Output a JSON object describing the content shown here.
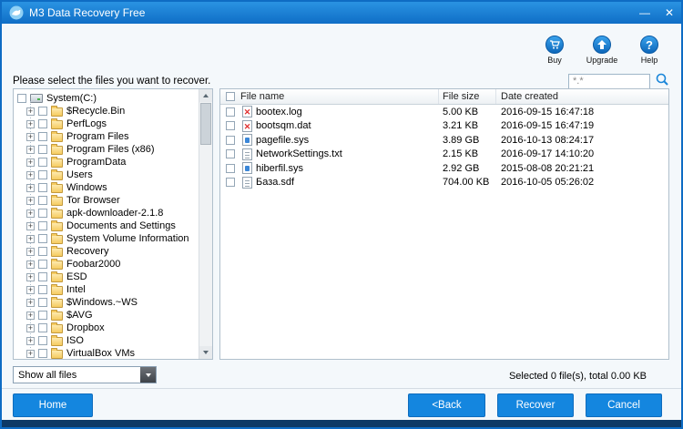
{
  "window": {
    "title": "M3 Data Recovery Free",
    "minimize": "—",
    "close": "✕"
  },
  "toolbar": {
    "items": [
      {
        "label": "Buy"
      },
      {
        "label": "Upgrade"
      },
      {
        "label": "Help"
      }
    ]
  },
  "instruction": "Please select the files you want to recover.",
  "search": {
    "value": "*.*"
  },
  "tree": {
    "root": "System(C:)",
    "items": [
      "$Recycle.Bin",
      "PerfLogs",
      "Program Files",
      "Program Files (x86)",
      "ProgramData",
      "Users",
      "Windows",
      "Tor Browser",
      "apk-downloader-2.1.8",
      "Documents and Settings",
      "System Volume Information",
      "Recovery",
      "Foobar2000",
      "ESD",
      "Intel",
      "$Windows.~WS",
      "$AVG",
      "Dropbox",
      "ISO",
      "VirtualBox VMs"
    ]
  },
  "filter": {
    "value": "Show all files"
  },
  "file_table": {
    "headers": [
      "File name",
      "File size",
      "Date created"
    ],
    "rows": [
      {
        "name": "bootex.log",
        "size": "5.00 KB",
        "date": "2016-09-15 16:47:18",
        "icon": "deleted-file-icon"
      },
      {
        "name": "bootsqm.dat",
        "size": "3.21 KB",
        "date": "2016-09-15 16:47:19",
        "icon": "deleted-file-icon"
      },
      {
        "name": "pagefile.sys",
        "size": "3.89 GB",
        "date": "2016-10-13 08:24:17",
        "icon": "system-file-icon"
      },
      {
        "name": "NetworkSettings.txt",
        "size": "2.15 KB",
        "date": "2016-09-17 14:10:20",
        "icon": "text-file-icon"
      },
      {
        "name": "hiberfil.sys",
        "size": "2.92 GB",
        "date": "2015-08-08 20:21:21",
        "icon": "system-file-icon"
      },
      {
        "name": "База.sdf",
        "size": "704.00 KB",
        "date": "2016-10-05 05:26:02",
        "icon": "text-file-icon"
      }
    ]
  },
  "status": "Selected 0 file(s), total 0.00 KB",
  "buttons": {
    "home": "Home",
    "back": "<Back",
    "recover": "Recover",
    "cancel": "Cancel"
  },
  "colors": {
    "titlebar": "#1579d6",
    "accent": "#1486df",
    "footer": "#0d3a66"
  }
}
